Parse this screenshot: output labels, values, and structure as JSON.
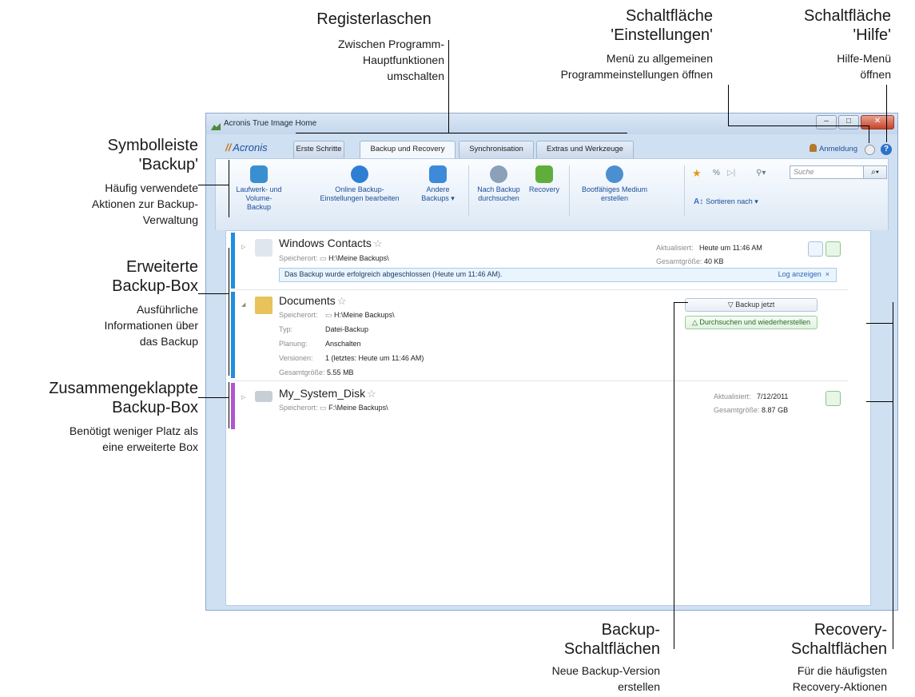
{
  "annotations": {
    "tabs": {
      "title": "Registerlaschen",
      "desc": [
        "Zwischen Programm-",
        "Hauptfunktionen",
        "umschalten"
      ]
    },
    "settings": {
      "title": [
        "Schaltfläche",
        "'Einstellungen'"
      ],
      "desc": [
        "Menü zu allgemeinen",
        "Programmeinstellungen öffnen"
      ]
    },
    "help": {
      "title": [
        "Schaltfläche",
        "'Hilfe'"
      ],
      "desc": [
        "Hilfe-Menü",
        "öffnen"
      ]
    },
    "toolbar": {
      "title": [
        "Symbolleiste",
        "'Backup'"
      ],
      "desc": [
        "Häufig verwendete",
        "Aktionen zur Backup-",
        "Verwaltung"
      ]
    },
    "expanded": {
      "title": [
        "Erweiterte",
        "Backup-Box"
      ],
      "desc": [
        "Ausführliche",
        "Informationen über",
        "das Backup"
      ]
    },
    "collapsed": {
      "title": [
        "Zusammengeklappte",
        "Backup-Box"
      ],
      "desc": [
        "Benötigt weniger Platz als",
        "eine erweiterte Box"
      ]
    },
    "backup_buttons": {
      "title": [
        "Backup-",
        "Schaltflächen"
      ],
      "desc": [
        "Neue Backup-Version",
        "erstellen"
      ]
    },
    "recovery_buttons": {
      "title": [
        "Recovery-",
        "Schaltflächen"
      ],
      "desc": [
        "Für die häufigsten",
        "Recovery-Aktionen"
      ]
    }
  },
  "window": {
    "title": "Acronis True Image Home",
    "logo": "Acronis",
    "login": "Anmeldung",
    "tabs": [
      "Erste Schritte",
      "Backup und Recovery",
      "Synchronisation",
      "Extras und Werkzeuge"
    ],
    "active_tab": "Backup und Recovery"
  },
  "toolbar": {
    "buttons": [
      {
        "label": [
          "Laufwerk- und Volume-",
          "Backup"
        ],
        "icon": "disk-backup-icon",
        "color": "#3a8fd1"
      },
      {
        "label": [
          "Online Backup-",
          "Einstellungen bearbeiten"
        ],
        "icon": "online-backup-icon",
        "color": "#2e7fd3"
      },
      {
        "label": [
          "Andere",
          "Backups ▾"
        ],
        "icon": "other-backups-icon",
        "color": "#3d8ad9"
      },
      {
        "label": [
          "Nach Backup",
          "durchsuchen"
        ],
        "icon": "browse-backup-icon",
        "color": "#8aa1b9"
      },
      {
        "label": [
          "Recovery"
        ],
        "icon": "recovery-icon",
        "color": "#5fae3c"
      },
      {
        "label": [
          "Bootfähiges Medium",
          "erstellen"
        ],
        "icon": "bootable-media-icon",
        "color": "#4b8fd0"
      }
    ],
    "search_placeholder": "Suche",
    "sort_label": "Sortieren nach ▾"
  },
  "boxes": {
    "windows_contacts": {
      "name": "Windows Contacts",
      "location_label": "Speicherort:",
      "location_value": "H:\\Meine Backups\\",
      "updated_label": "Aktualisiert:",
      "updated_value": "Heute um 11:46 AM",
      "size_label": "Gesamtgröße:",
      "size_value": "40 KB",
      "status": "Das Backup wurde erfolgreich abgeschlossen (Heute um 11:46 AM).",
      "log_link": "Log anzeigen",
      "close": "×",
      "accent": "#1e8fe0"
    },
    "documents": {
      "name": "Documents",
      "location_label": "Speicherort:",
      "location_value": "H:\\Meine Backups\\",
      "type_label": "Typ:",
      "type_value": "Datei-Backup",
      "schedule_label": "Planung:",
      "schedule_value": "Anschalten",
      "versions_label": "Versionen:",
      "versions_value": "1 (letztes: Heute um 11:46 AM)",
      "size_label": "Gesamtgröße:",
      "size_value": "5.55 MB",
      "backup_now": "Backup jetzt",
      "browse_restore": "Durchsuchen und wiederherstellen",
      "accent": "#1e8fe0"
    },
    "system_disk": {
      "name": "My_System_Disk",
      "location_label": "Speicherort:",
      "location_value": "F:\\Meine Backups\\",
      "updated_label": "Aktualisiert:",
      "updated_value": "7/12/2011",
      "size_label": "Gesamtgröße:",
      "size_value": "8.87 GB",
      "accent": "#b054d2"
    }
  }
}
